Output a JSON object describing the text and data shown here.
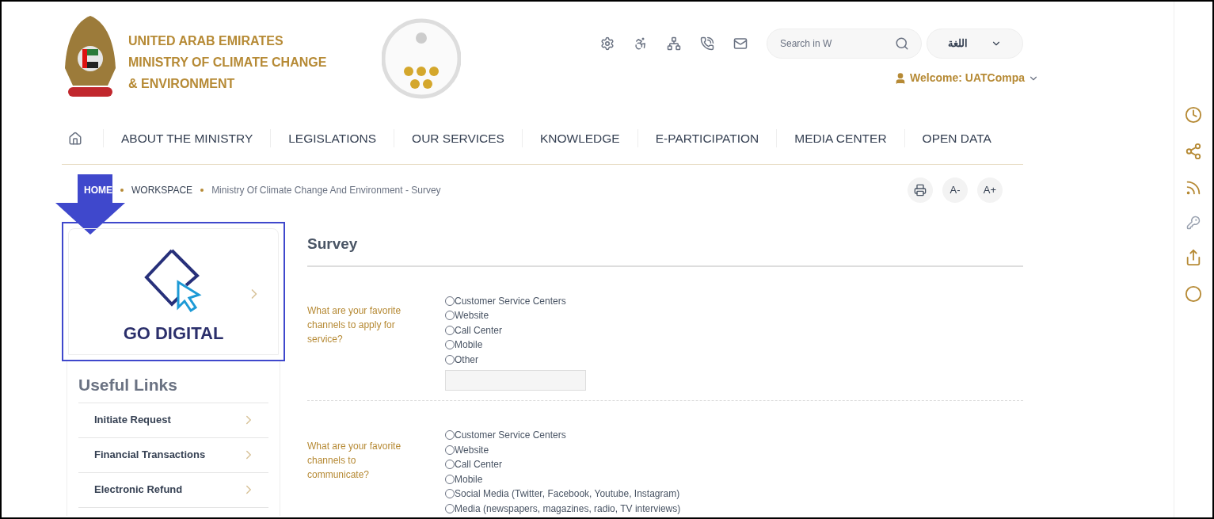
{
  "header": {
    "org_lines": [
      "UNITED ARAB EMIRATES",
      "MINISTRY OF CLIMATE CHANGE",
      "& ENVIRONMENT"
    ],
    "search": {
      "placeholder": "Search in W"
    },
    "language": "اللغة",
    "welcome": "Welcome: UATCompa"
  },
  "nav": [
    "ABOUT THE MINISTRY",
    "LEGISLATIONS",
    "OUR SERVICES",
    "KNOWLEDGE",
    "E-PARTICIPATION",
    "MEDIA CENTER",
    "OPEN DATA"
  ],
  "breadcrumb": [
    "HOME",
    "WORKSPACE",
    "Ministry Of Climate Change And Environment - Survey"
  ],
  "font_controls": [
    "A-",
    "A+"
  ],
  "go_digital": {
    "label": "GO DIGITAL"
  },
  "useful_links": {
    "title": "Useful Links",
    "items": [
      "Initiate Request",
      "Financial Transactions",
      "Electronic Refund"
    ]
  },
  "survey": {
    "title": "Survey",
    "questions": [
      {
        "text": "What are your favorite channels to apply for service?",
        "other_field": true,
        "options": [
          {
            "label": "Customer Service Centers",
            "selected": false
          },
          {
            "label": "Website",
            "selected": false
          },
          {
            "label": "Call Center",
            "selected": false
          },
          {
            "label": "Mobile",
            "selected": false
          },
          {
            "label": "Other",
            "selected": false
          }
        ]
      },
      {
        "text": "What are your favorite channels to communicate?",
        "options": [
          {
            "label": "Customer Service Centers",
            "selected": false
          },
          {
            "label": "Website",
            "selected": false
          },
          {
            "label": "Call Center",
            "selected": false
          },
          {
            "label": "Mobile",
            "selected": false
          },
          {
            "label": "Social Media (Twitter, Facebook, Youtube, Instagram)",
            "selected": false
          },
          {
            "label": "Media (newspapers, magazines, radio, TV interviews)",
            "selected": false
          }
        ]
      }
    ]
  }
}
